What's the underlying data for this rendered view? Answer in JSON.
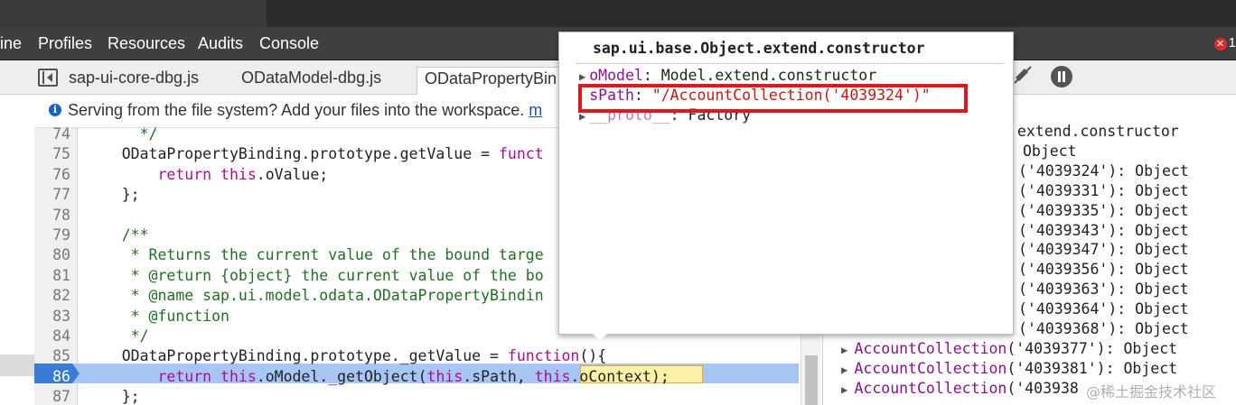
{
  "menu": {
    "items": [
      "ine",
      "Profiles",
      "Resources",
      "Audits",
      "Console"
    ],
    "error_count": "1"
  },
  "file_tabs": [
    "sap-ui-core-dbg.js",
    "ODataModel-dbg.js",
    "ODataPropertyBin"
  ],
  "infobar": {
    "text": "Serving from the file system? Add your files into the workspace.",
    "link": "m"
  },
  "code_lines": [
    {
      "n": "74",
      "parts": [
        {
          "t": "      */",
          "c": "cm"
        }
      ]
    },
    {
      "n": "75",
      "parts": [
        {
          "t": "    ODataPropertyBinding.prototype.getValue = ",
          "c": "pl"
        },
        {
          "t": "funct",
          "c": "kw"
        }
      ]
    },
    {
      "n": "76",
      "parts": [
        {
          "t": "        ",
          "c": "pl"
        },
        {
          "t": "return this",
          "c": "kw"
        },
        {
          "t": ".oValue;",
          "c": "pl"
        }
      ]
    },
    {
      "n": "77",
      "parts": [
        {
          "t": "    };",
          "c": "pl"
        }
      ]
    },
    {
      "n": "78",
      "parts": []
    },
    {
      "n": "79",
      "parts": [
        {
          "t": "    /**",
          "c": "cm"
        }
      ]
    },
    {
      "n": "80",
      "parts": [
        {
          "t": "     * Returns the current value of the bound targe",
          "c": "cm"
        }
      ]
    },
    {
      "n": "81",
      "parts": [
        {
          "t": "     * @return {object} the current value of the bo",
          "c": "cm"
        }
      ]
    },
    {
      "n": "82",
      "parts": [
        {
          "t": "     * @name sap.ui.model.odata.ODataPropertyBindin",
          "c": "cm"
        }
      ]
    },
    {
      "n": "83",
      "parts": [
        {
          "t": "     * @function",
          "c": "cm"
        }
      ]
    },
    {
      "n": "84",
      "parts": [
        {
          "t": "     */",
          "c": "cm"
        }
      ]
    },
    {
      "n": "85",
      "parts": [
        {
          "t": "    ODataPropertyBinding.prototype._getValue = ",
          "c": "pl"
        },
        {
          "t": "function",
          "c": "kw"
        },
        {
          "t": "(){",
          "c": "pl"
        }
      ]
    },
    {
      "n": "86",
      "parts": [
        {
          "t": "        ",
          "c": "pl"
        },
        {
          "t": "return this",
          "c": "kw"
        },
        {
          "t": ".oModel._getObject(",
          "c": "pl"
        },
        {
          "t": "this",
          "c": "kw"
        },
        {
          "t": ".sPath, ",
          "c": "pl"
        },
        {
          "t": "this",
          "c": "kw"
        },
        {
          "t": ".oContext);",
          "c": "pl"
        }
      ]
    },
    {
      "n": "87",
      "parts": [
        {
          "t": "    };",
          "c": "pl"
        }
      ]
    }
  ],
  "scope": {
    "rows": [
      {
        "tri": false,
        "name": "",
        "value": "    .extend.constructor"
      },
      {
        "tri": false,
        "name": "",
        "value": "    Object"
      },
      {
        "tri": false,
        "name": "",
        "value": "   ('4039324'): Object"
      },
      {
        "tri": false,
        "name": "",
        "value": "   ('4039331'): Object"
      },
      {
        "tri": false,
        "name": "",
        "value": "   ('4039335'): Object"
      },
      {
        "tri": false,
        "name": "",
        "value": "   ('4039343'): Object"
      },
      {
        "tri": false,
        "name": "",
        "value": "   ('4039347'): Object"
      },
      {
        "tri": false,
        "name": "",
        "value": "   ('4039356'): Object"
      },
      {
        "tri": false,
        "name": "",
        "value": "   ('4039363'): Object"
      },
      {
        "tri": false,
        "name": "",
        "value": "   ('4039364'): Object"
      },
      {
        "tri": false,
        "name": "",
        "value": "   ('4039368'): Object"
      },
      {
        "tri": true,
        "name": "AccountCollection",
        "value": "('4039377'): Object"
      },
      {
        "tri": true,
        "name": "AccountCollection",
        "value": "('4039381'): Object"
      },
      {
        "tri": true,
        "name": "AccountCollection",
        "value": "('403938"
      }
    ]
  },
  "popover": {
    "title": "sap.ui.base.Object.extend.constructor",
    "rows": [
      {
        "name": "oModel",
        "sep": ": ",
        "value": "Model.extend.constructor",
        "vclass": "pl",
        "tri": true
      },
      {
        "name": "sPath",
        "sep": ": ",
        "value": "\"/AccountCollection('4039324')\"",
        "vclass": "str",
        "tri": false
      },
      {
        "name": "__proto__",
        "sep": ": ",
        "value": "Factory",
        "vclass": "pl",
        "tri": true
      }
    ]
  },
  "watermark": "@稀土掘金技术社区",
  "colors": {
    "highlight": "#a8c6f5",
    "redbox": "#e3161d",
    "keyword": "#aa0d91",
    "comment": "#236e25",
    "string": "#c41a16"
  }
}
